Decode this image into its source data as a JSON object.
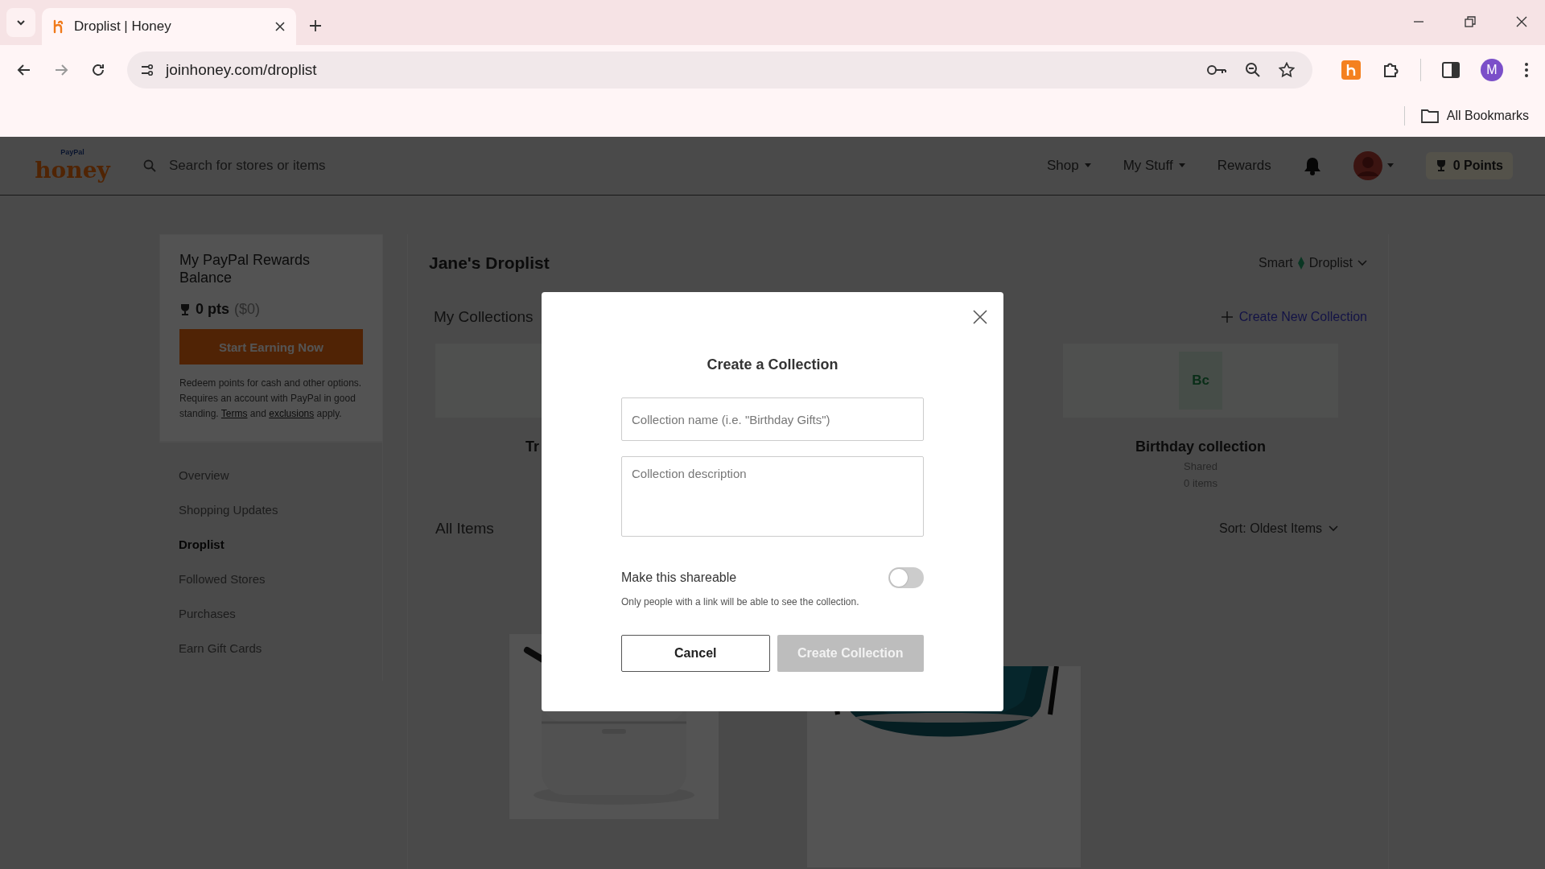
{
  "browser": {
    "tabs": [
      {
        "title": "Droplist | Honey",
        "selected": true
      }
    ],
    "url": "joinhoney.com/droplist",
    "profile_initial": "M",
    "bookmarks": "All Bookmarks"
  },
  "header": {
    "logo_small": "PayPal",
    "logo": "honey",
    "search": {
      "placeholder": "Search for stores or items"
    },
    "nav": [
      {
        "label": "Shop",
        "dropdown": true
      },
      {
        "label": "My Stuff",
        "dropdown": true
      },
      {
        "label": "Rewards",
        "dropdown": false
      }
    ],
    "points": "0 Points"
  },
  "sidebar": {
    "rewards_title": "My PayPal Rewards Balance",
    "points": "0 pts",
    "points_value": "($0)",
    "earn_button": "Start Earning Now",
    "note": [
      {
        "text": "Redeem points for cash and other options. Requires an account with PayPal in good standing. ",
        "link": false
      },
      {
        "text": "Terms",
        "link": true
      },
      {
        "text": " and ",
        "link": false
      },
      {
        "text": "exclusions",
        "link": true
      },
      {
        "text": " apply.",
        "link": false
      }
    ],
    "nav": [
      {
        "label": "Overview",
        "selected": false
      },
      {
        "label": "Shopping Updates",
        "selected": false
      },
      {
        "label": "Droplist",
        "selected": true
      },
      {
        "label": "Followed Stores",
        "selected": false
      },
      {
        "label": "Purchases",
        "selected": false
      },
      {
        "label": "Earn Gift Cards",
        "selected": false
      }
    ]
  },
  "main": {
    "title": "Jane's Droplist",
    "smart_label": "Smart",
    "droplist_label": "Droplist",
    "collections_heading": "My Collections",
    "create_link": "Create New Collection",
    "collections": [
      {
        "title": "Tr"
      },
      {
        "initials": "Bc",
        "title": "Birthday collection",
        "status": "Shared",
        "count": "0 items"
      }
    ],
    "items_heading": "All Items",
    "sort": "Sort: Oldest Items"
  },
  "modal": {
    "title": "Create a Collection",
    "name_placeholder": "Collection name (i.e. \"Birthday Gifts\")",
    "description_placeholder": "Collection description",
    "shareable_label": "Make this shareable",
    "shareable": {
      "on": false
    },
    "shareable_note": "Only people with a link will be able to see the collection.",
    "cancel": "Cancel",
    "create": {
      "label": "Create Collection",
      "disabled": true
    }
  }
}
